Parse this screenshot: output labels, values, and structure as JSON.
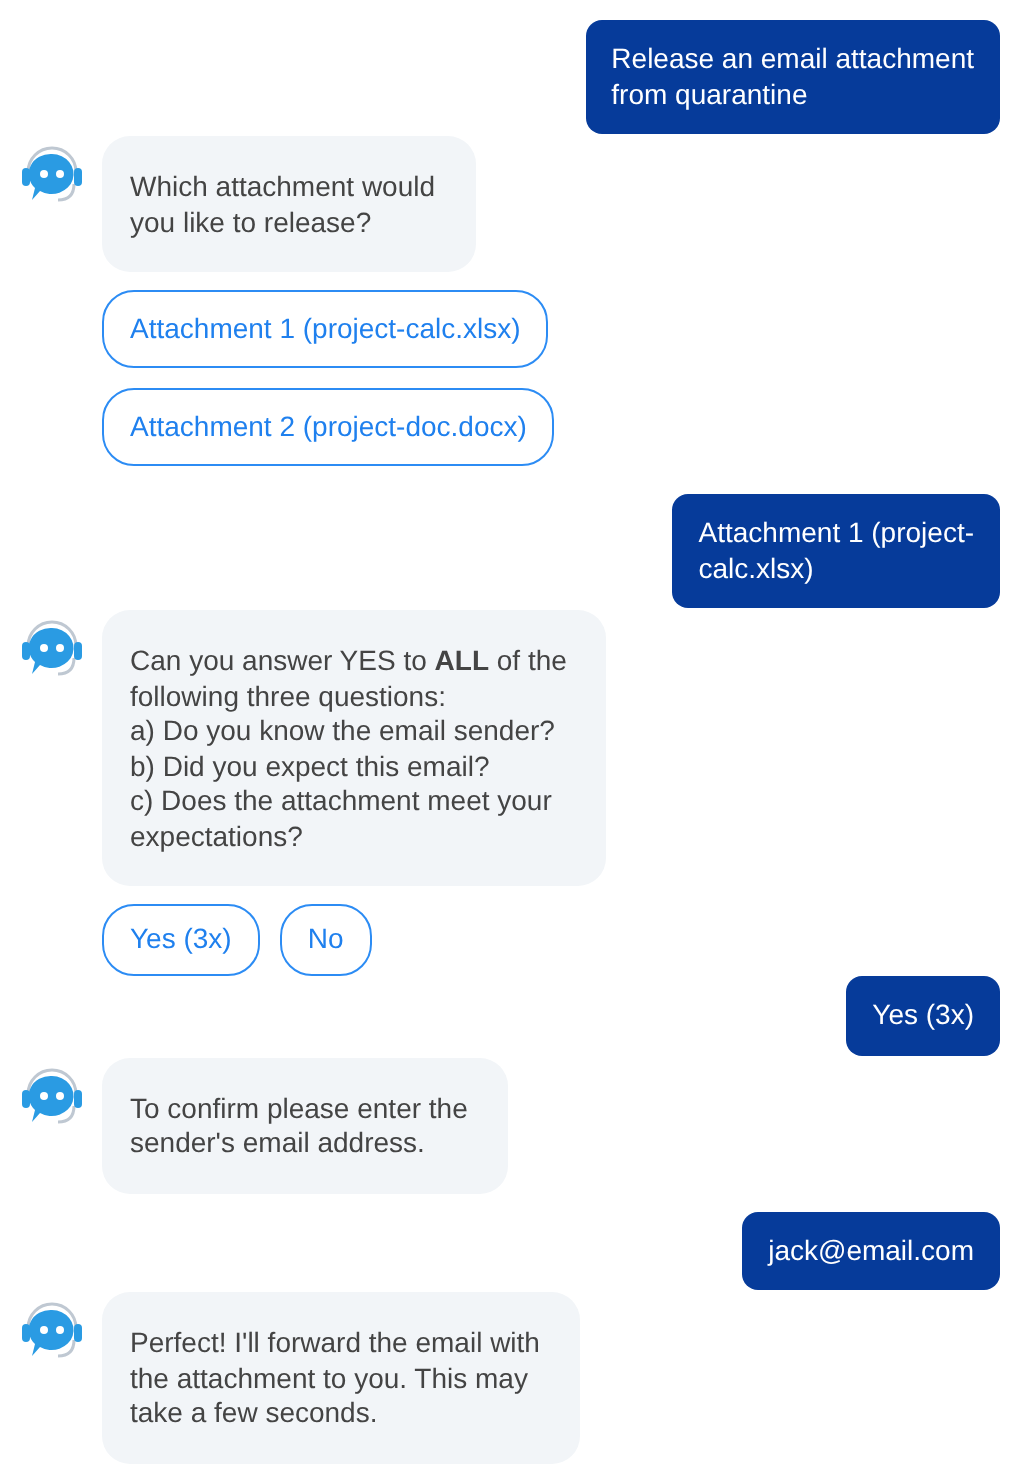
{
  "messages": [
    {
      "kind": "user",
      "lines": [
        "Release an email attachment",
        "from quarantine"
      ]
    },
    {
      "kind": "bot",
      "lines": [
        "Which attachment would",
        "you like to release?"
      ]
    },
    {
      "kind": "options_column",
      "options": [
        "Attachment 1 (project-calc.xlsx)",
        "Attachment 2 (project-doc.docx)"
      ]
    },
    {
      "kind": "user",
      "lines": [
        "Attachment 1 (project-",
        "calc.xlsx)"
      ]
    },
    {
      "kind": "bot",
      "lines": [
        "Can you answer YES to **ALL** of the",
        "following  three questions:",
        "a) Do you know the email sender?",
        "b) Did you expect this email?",
        "c) Does the attachment meet your",
        "expectations?"
      ]
    },
    {
      "kind": "options_row",
      "options": [
        "Yes (3x)",
        "No"
      ]
    },
    {
      "kind": "user",
      "lines": [
        "Yes (3x)"
      ]
    },
    {
      "kind": "bot",
      "lines": [
        "To confirm please enter the",
        "sender's email address."
      ]
    },
    {
      "kind": "user",
      "lines": [
        "jack@email.com"
      ]
    },
    {
      "kind": "bot",
      "lines": [
        "Perfect! I'll forward the email with",
        "the attachment to you. This may",
        "take a few seconds."
      ]
    }
  ]
}
